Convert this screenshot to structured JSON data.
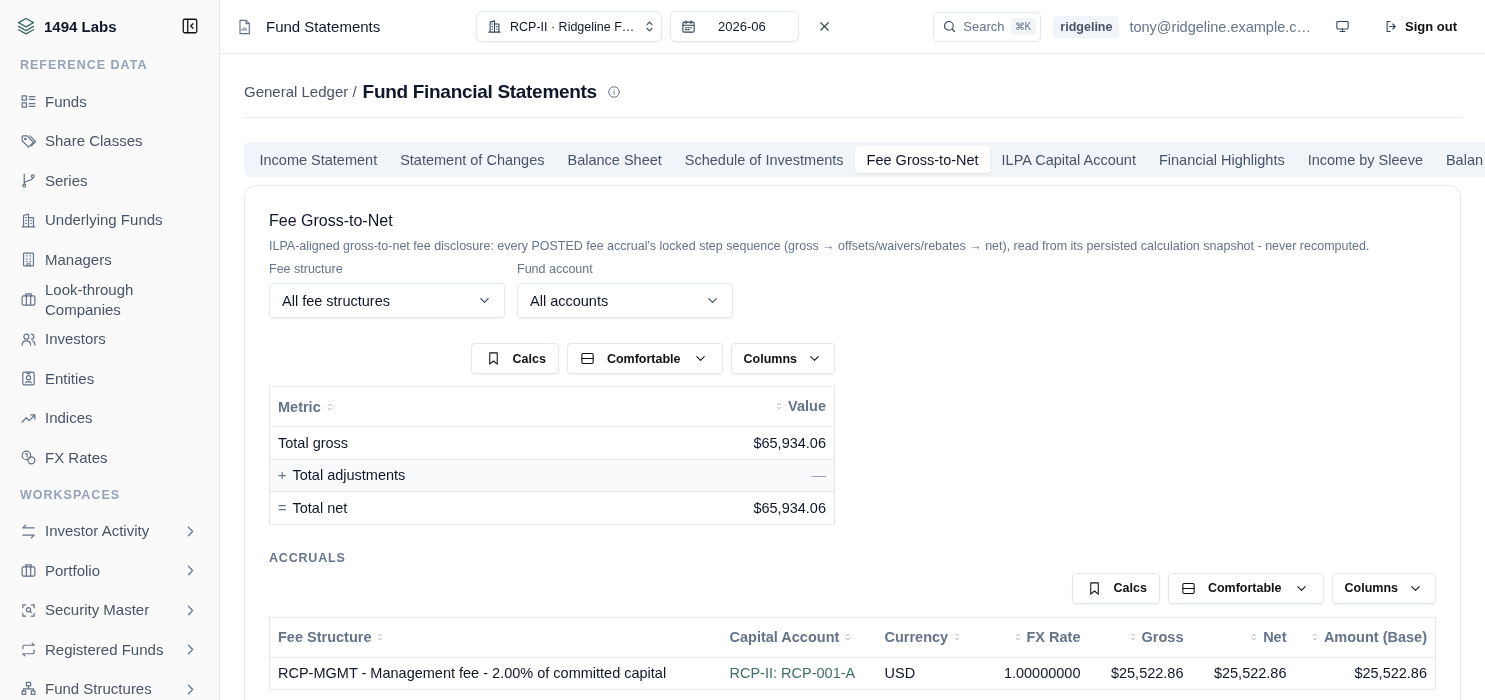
{
  "app": {
    "brand": "1494 Labs"
  },
  "sidebar": {
    "sections": [
      {
        "heading": "REFERENCE DATA",
        "items": [
          {
            "label": "Funds"
          },
          {
            "label": "Share Classes"
          },
          {
            "label": "Series"
          },
          {
            "label": "Underlying Funds"
          },
          {
            "label": "Managers"
          },
          {
            "label": "Look-through Companies"
          },
          {
            "label": "Investors"
          },
          {
            "label": "Entities"
          },
          {
            "label": "Indices"
          },
          {
            "label": "FX Rates"
          }
        ]
      },
      {
        "heading": "WORKSPACES",
        "items": [
          {
            "label": "Investor Activity",
            "expanded": false
          },
          {
            "label": "Portfolio",
            "expanded": false
          },
          {
            "label": "Security Master",
            "expanded": false
          },
          {
            "label": "Registered Funds",
            "expanded": false
          },
          {
            "label": "Fund Structures",
            "expanded": false
          }
        ]
      }
    ]
  },
  "header": {
    "page_title": "Fund Statements",
    "fund": "RCP-II · Ridgeline F…",
    "period": "2026-06",
    "search": {
      "placeholder": "Search",
      "shortcut": "⌘K"
    },
    "tenant": "ridgeline",
    "user": "tony@ridgeline.example.c…",
    "sign_out": "Sign out"
  },
  "breadcrumb": {
    "parent": "General Ledger /",
    "title": "Fund Financial Statements"
  },
  "tabs": [
    {
      "label": "Income Statement",
      "selected": false
    },
    {
      "label": "Statement of Changes",
      "selected": false
    },
    {
      "label": "Balance Sheet",
      "selected": false
    },
    {
      "label": "Schedule of Investments",
      "selected": false
    },
    {
      "label": "Fee Gross-to-Net",
      "selected": true
    },
    {
      "label": "ILPA Capital Account",
      "selected": false
    },
    {
      "label": "Financial Highlights",
      "selected": false
    },
    {
      "label": "Income by Sleeve",
      "selected": false
    },
    {
      "label": "Balan",
      "selected": false
    }
  ],
  "card": {
    "title": "Fee Gross-to-Net",
    "description": "ILPA-aligned gross-to-net fee disclosure: every POSTED fee accrual's locked step sequence (gross → offsets/waivers/rebates → net), read from its persisted calculation snapshot - never recomputed.",
    "filters": [
      {
        "label": "Fee structure",
        "value": "All fee structures"
      },
      {
        "label": "Fund account",
        "value": "All accounts"
      }
    ],
    "summary": {
      "toolbar": [
        "Calcs",
        "Comfortable",
        "Columns"
      ],
      "columns": [
        {
          "label": "Metric",
          "kind": "text"
        },
        {
          "label": "Value",
          "kind": "number"
        }
      ],
      "rows": [
        {
          "metric": "Total gross",
          "value": "$65,934.06",
          "muted": false
        },
        {
          "prefix": "+",
          "metric": "Total adjustments",
          "value": "—",
          "muted": true
        },
        {
          "prefix": "=",
          "metric": "Total net",
          "value": "$65,934.06",
          "muted": false
        }
      ]
    },
    "accruals": {
      "heading": "ACCRUALS",
      "toolbar": [
        "Calcs",
        "Comfortable",
        "Columns"
      ],
      "columns": [
        {
          "label": "Fee Structure",
          "kind": "text"
        },
        {
          "label": "Capital Account",
          "kind": "text"
        },
        {
          "label": "Currency",
          "kind": "text"
        },
        {
          "label": "FX Rate",
          "kind": "number"
        },
        {
          "label": "Gross",
          "kind": "number"
        },
        {
          "label": "Net",
          "kind": "number"
        },
        {
          "label": "Amount (Base)",
          "kind": "number"
        }
      ],
      "rows": [
        {
          "cells": [
            "RCP-MGMT - Management fee - 2.00% of committed capital",
            "RCP-II: RCP-001-A",
            "USD",
            "1.00000000",
            "$25,522.86",
            "$25,522.86",
            "$25,522.86"
          ]
        }
      ]
    }
  }
}
